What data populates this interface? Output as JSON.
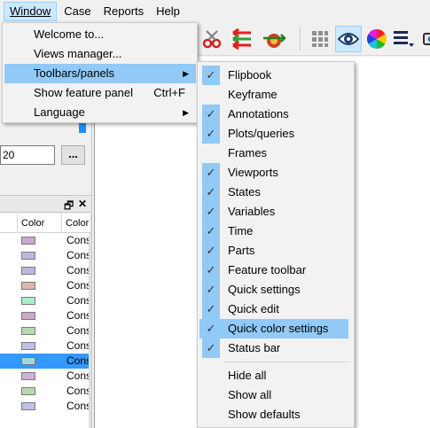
{
  "menubar": {
    "items": [
      {
        "label": "Window",
        "active": true
      },
      {
        "label": "Case",
        "active": false
      },
      {
        "label": "Reports",
        "active": false
      },
      {
        "label": "Help",
        "active": false
      }
    ]
  },
  "window_menu": {
    "items": [
      {
        "label": "Welcome to...",
        "shortcut": "",
        "submenu": false,
        "highlighted": false
      },
      {
        "label": "Views manager...",
        "shortcut": "",
        "submenu": false,
        "highlighted": false
      },
      {
        "label": "Toolbars/panels",
        "shortcut": "",
        "submenu": true,
        "highlighted": true
      },
      {
        "label": "Show feature panel",
        "shortcut": "Ctrl+F",
        "submenu": false,
        "highlighted": false
      },
      {
        "label": "Language",
        "shortcut": "",
        "submenu": true,
        "highlighted": false
      }
    ]
  },
  "toolbars_submenu": {
    "items": [
      {
        "label": "Flipbook",
        "checked": true
      },
      {
        "label": "Keyframe",
        "checked": false
      },
      {
        "label": "Annotations",
        "checked": true
      },
      {
        "label": "Plots/queries",
        "checked": true
      },
      {
        "label": "Frames",
        "checked": false
      },
      {
        "label": "Viewports",
        "checked": true
      },
      {
        "label": "States",
        "checked": true
      },
      {
        "label": "Variables",
        "checked": true
      },
      {
        "label": "Time",
        "checked": true
      },
      {
        "label": "Parts",
        "checked": true
      },
      {
        "label": "Feature toolbar",
        "checked": true
      },
      {
        "label": "Quick settings",
        "checked": true
      },
      {
        "label": "Quick edit",
        "checked": true
      },
      {
        "label": "Quick color settings",
        "checked": true,
        "highlighted": true
      },
      {
        "label": "Status bar",
        "checked": true
      }
    ],
    "actions": [
      "Hide all",
      "Show all",
      "Show defaults"
    ],
    "check_glyph": "✓"
  },
  "left_panel": {
    "field_value": "20",
    "ellipsis_button": "...",
    "dock_controls": {
      "restore": "🗗",
      "close": "✕"
    },
    "columns": [
      "Color",
      "Color"
    ],
    "rows": [
      {
        "swatch": "#c8a8d0",
        "text": "Cons",
        "selected": false
      },
      {
        "swatch": "#b8b8e0",
        "text": "Cons",
        "selected": false
      },
      {
        "swatch": "#b8b8e0",
        "text": "Cons",
        "selected": false
      },
      {
        "swatch": "#d8b8a8",
        "text": "Cons",
        "selected": false
      },
      {
        "swatch": "#a8f0c8",
        "text": "Cons",
        "selected": false
      },
      {
        "swatch": "#d0a8c8",
        "text": "Cons",
        "selected": false
      },
      {
        "swatch": "#b8d8b0",
        "text": "Cons",
        "selected": false
      },
      {
        "swatch": "#c0c0e8",
        "text": "Cons",
        "selected": false
      },
      {
        "swatch": "#a0d8e0",
        "text": "Cons",
        "selected": true
      },
      {
        "swatch": "#d0b0e0",
        "text": "Cons",
        "selected": false
      },
      {
        "swatch": "#b8d8b0",
        "text": "Cons",
        "selected": false
      },
      {
        "swatch": "#c0c0e8",
        "text": "Cons",
        "selected": false
      }
    ]
  },
  "toolbar_icons": [
    "scissors-icon",
    "arrows-icon",
    "target-arrow-icon",
    "mesh-icon",
    "eye-icon",
    "color-wheel-icon",
    "layers-icon",
    "camera-icon"
  ],
  "colors": {
    "highlight": "#91c9f7",
    "selection": "#3399ff",
    "accent": "#1e90ff"
  }
}
